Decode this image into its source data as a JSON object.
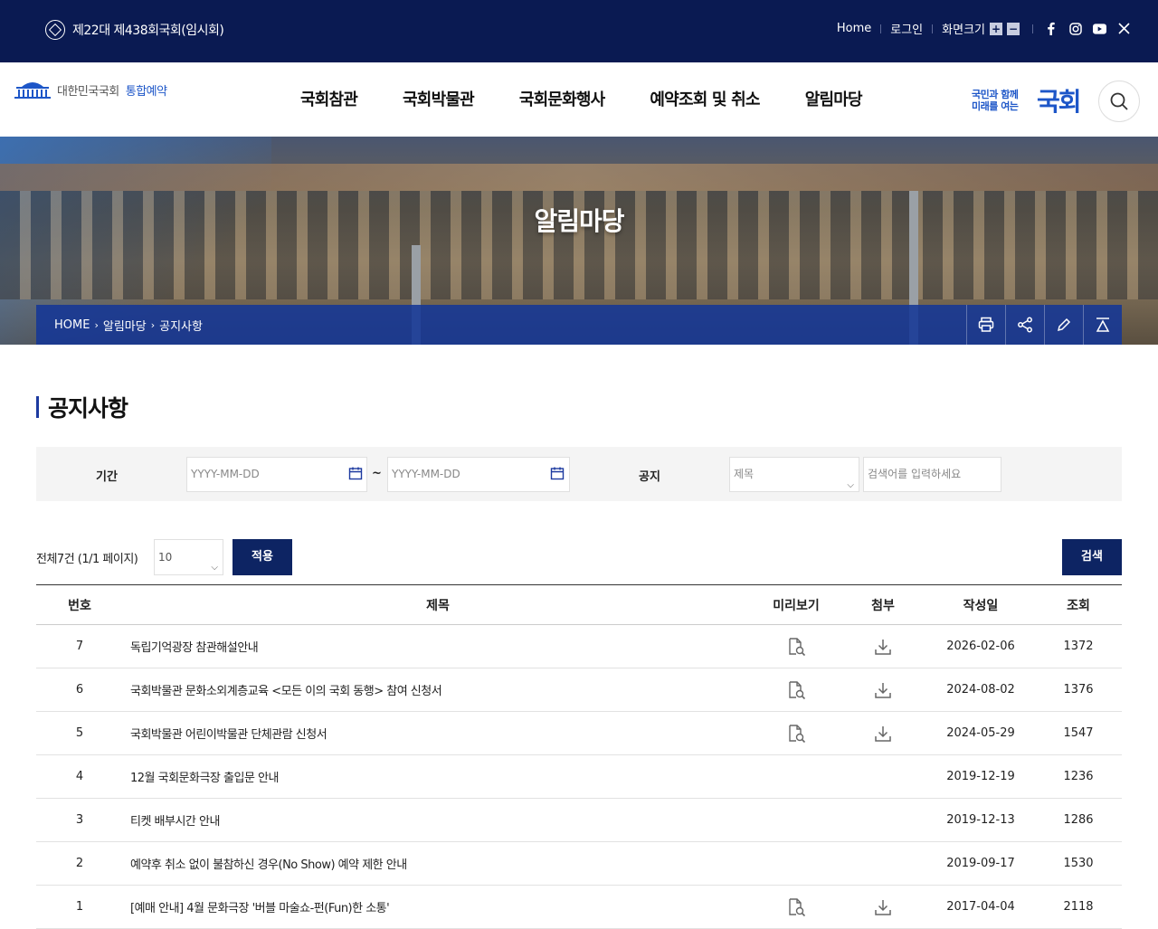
{
  "topbar": {
    "session": "제22대 제438회국회(임시회)",
    "links": {
      "home": "Home",
      "login": "로그인",
      "font_size": "화면크기"
    },
    "zoom_in": "+",
    "zoom_out": "−"
  },
  "header": {
    "logo_text": "대한민국국회",
    "logo_sub": "통합예약",
    "nav": [
      "국회참관",
      "국회박물관",
      "국회문화행사",
      "예약조회 및 취소",
      "알림마당"
    ],
    "slogan_small_line1": "국민과 함께",
    "slogan_small_line2": "미래를 여는",
    "slogan_big": "국회"
  },
  "hero": {
    "title": "알림마당",
    "breadcrumb": [
      "HOME",
      "알림마당",
      "공지사항"
    ]
  },
  "page": {
    "title": "공지사항"
  },
  "filter": {
    "period_label": "기간",
    "date_placeholder_start": "YYYY-MM-DD",
    "date_placeholder_end": "YYYY-MM-DD",
    "tilde": "~",
    "notice_label": "공지",
    "select_value": "제목",
    "keyword_placeholder": "검색어를 입력하세요"
  },
  "listbar": {
    "total": "전체7건 (1/1 페이지)",
    "page_size": "10",
    "apply": "적용",
    "search": "검색"
  },
  "table": {
    "headers": [
      "번호",
      "제목",
      "미리보기",
      "첨부",
      "작성일",
      "조회"
    ],
    "rows": [
      {
        "no": "7",
        "title": "독립기억광장 참관해설안내",
        "preview": true,
        "attach": true,
        "date": "2026-02-06",
        "views": "1372"
      },
      {
        "no": "6",
        "title": "국회박물관 문화소외계층교육 <모든 이의 국회 동행> 참여 신청서",
        "preview": true,
        "attach": true,
        "date": "2024-08-02",
        "views": "1376"
      },
      {
        "no": "5",
        "title": "국회박물관 어린이박물관 단체관람 신청서",
        "preview": true,
        "attach": true,
        "date": "2024-05-29",
        "views": "1547"
      },
      {
        "no": "4",
        "title": "12월 국회문화극장 출입문 안내",
        "preview": false,
        "attach": false,
        "date": "2019-12-19",
        "views": "1236"
      },
      {
        "no": "3",
        "title": "티켓 배부시간 안내",
        "preview": false,
        "attach": false,
        "date": "2019-12-13",
        "views": "1286"
      },
      {
        "no": "2",
        "title": "예약후 취소 없이 불참하신 경우(No Show) 예약 제한 안내",
        "preview": false,
        "attach": false,
        "date": "2019-09-17",
        "views": "1530"
      },
      {
        "no": "1",
        "title": "[예매 안내] 4월 문화극장 '버블 마술쇼-펀(Fun)한 소통'",
        "preview": true,
        "attach": true,
        "date": "2017-04-04",
        "views": "2118"
      }
    ]
  },
  "colors": {
    "navy": "#0a1a52",
    "accent": "#1d56c8",
    "button": "#0d2463"
  }
}
